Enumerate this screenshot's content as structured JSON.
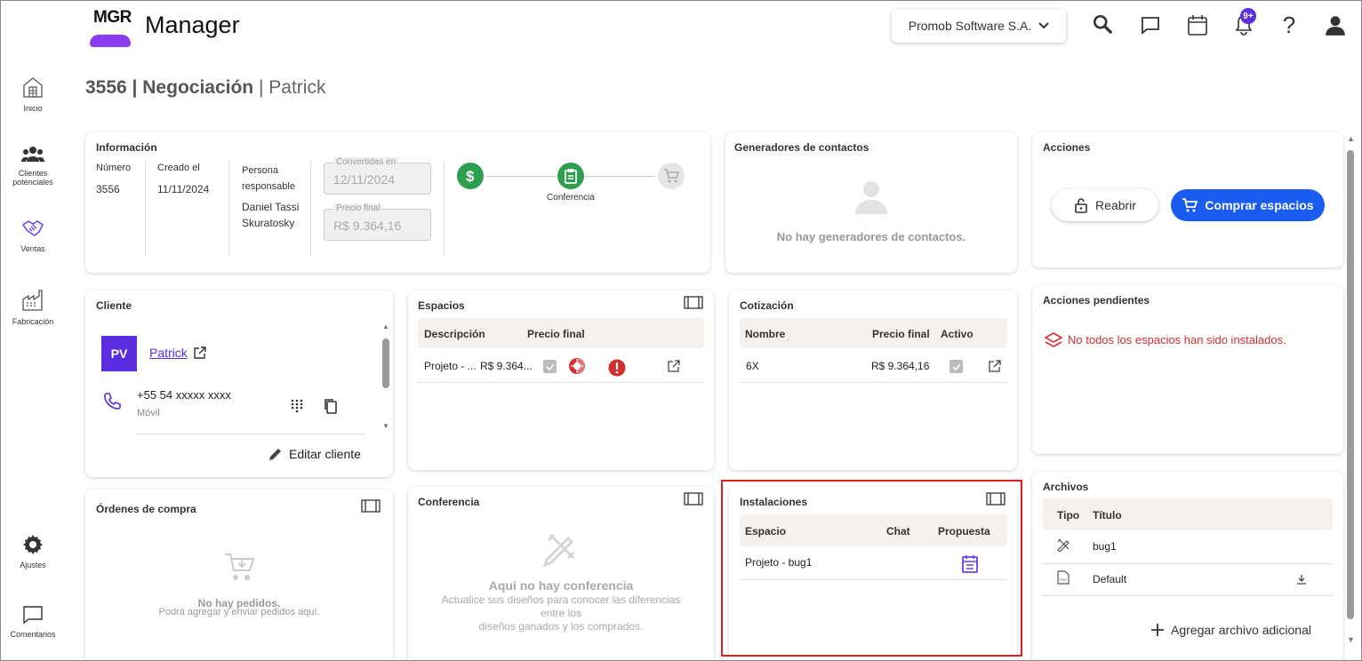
{
  "header": {
    "logo_text": "MGR",
    "app_title": "Manager",
    "company": "Promob Software S.A.",
    "notifications_badge": "9+"
  },
  "sidebar": {
    "items": [
      {
        "label": "Inicio",
        "icon": "home-icon"
      },
      {
        "label": "Clientes potenciales",
        "icon": "people-icon"
      },
      {
        "label": "Ventas",
        "icon": "handshake-icon"
      },
      {
        "label": "Fabricación",
        "icon": "factory-icon"
      },
      {
        "label": "Ajustes",
        "icon": "gear-icon"
      },
      {
        "label": "Comentarios",
        "icon": "comment-icon"
      }
    ]
  },
  "page": {
    "id": "3556",
    "stage": "Negociación",
    "owner": "Patrick"
  },
  "informacion": {
    "title": "Información",
    "numero_label": "Número",
    "numero": "3556",
    "creado_label": "Creado el",
    "creado": "11/11/2024",
    "responsable_label": "Persona responsable",
    "responsable": "Daniel Tassi Skuratosky",
    "convertidas_label": "Convertidas en",
    "convertidas": "12/11/2024",
    "precio_label": "Precio final",
    "precio": "R$ 9.364,16",
    "step_label": "Conferencia"
  },
  "generadores": {
    "title": "Generadores de contactos",
    "empty": "No hay generadores de contactos."
  },
  "acciones": {
    "title": "Acciones",
    "reabrir": "Reabrir",
    "comprar": "Comprar espacios"
  },
  "cliente": {
    "title": "Cliente",
    "initials": "PV",
    "name": "Patrick",
    "phone": "+55 54  xxxxx xxxx",
    "phone_type": "Móvil",
    "edit": "Editar cliente"
  },
  "espacios": {
    "title": "Espacios",
    "headers": [
      "Descripción",
      "Precio final"
    ],
    "row": {
      "desc": "Projeto - ...",
      "price": "R$ 9.364..."
    }
  },
  "cotizacion": {
    "title": "Cotización",
    "headers": [
      "Nombre",
      "Precio final",
      "Activo"
    ],
    "row": {
      "name": "6X",
      "price": "R$ 9.364,16"
    }
  },
  "pendientes": {
    "title": "Acciones pendientes",
    "message": "No todos los espacios han sido instalados."
  },
  "ordenes": {
    "title": "Órdenes de compra",
    "empty_title": "No hay pedidos.",
    "empty_sub": "Podrá agregar y enviar pedidos aquí."
  },
  "conferencia": {
    "title": "Conferencia",
    "empty_title": "Aquí no hay conferencia",
    "empty_line1": "Actualice sus diseños para conocer las diferencias",
    "empty_line2": "entre los",
    "empty_line3": "diseños ganados y los comprados."
  },
  "instalaciones": {
    "title": "Instalaciones",
    "headers": [
      "Espacio",
      "Chat",
      "Propuesta"
    ],
    "row": {
      "espacio": "Projeto - bug1"
    }
  },
  "archivos": {
    "title": "Archivos",
    "headers": [
      "Tipo",
      "Título"
    ],
    "rows": [
      {
        "title": "bug1",
        "icon": "tools-icon"
      },
      {
        "title": "Default",
        "icon": "pdf-icon"
      }
    ],
    "add": "Agregar archivo adicional"
  },
  "colors": {
    "accent": "#1a5cf0",
    "purple": "#5b2de0",
    "green": "#2e9e4f",
    "red": "#d32f2f",
    "highlight": "#e02020"
  }
}
